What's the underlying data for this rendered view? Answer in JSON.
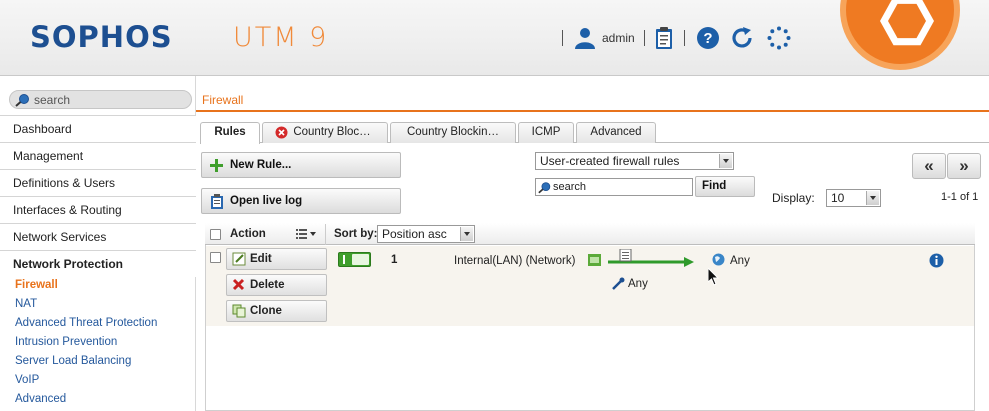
{
  "header": {
    "logo": "SOPHOS",
    "product": "UTM 9",
    "user": "admin"
  },
  "sidebar": {
    "search_placeholder": "search",
    "items": [
      "Dashboard",
      "Management",
      "Definitions & Users",
      "Interfaces & Routing",
      "Network Services",
      "Network Protection"
    ],
    "subitems": [
      "Firewall",
      "NAT",
      "Advanced Threat Protection",
      "Intrusion Prevention",
      "Server Load Balancing",
      "VoIP",
      "Advanced"
    ]
  },
  "breadcrumb": "Firewall",
  "tabs": [
    "Rules",
    "Country Bloc…",
    "Country Blockin…",
    "ICMP",
    "Advanced"
  ],
  "toolbar": {
    "new_rule": "New Rule...",
    "open_live_log": "Open live log",
    "filter_select": "User-created firewall rules",
    "search_value": "search",
    "find": "Find",
    "display_label": "Display:",
    "display_value": "10",
    "page_info": "1-1 of 1",
    "prev": "«",
    "next": "»"
  },
  "table": {
    "action_header": "Action",
    "sort_label": "Sort by:",
    "sort_value": "Position asc",
    "rows": [
      {
        "edit": "Edit",
        "delete": "Delete",
        "clone": "Clone",
        "position": "1",
        "source": "Internal(LAN) (Network)",
        "destination": "Any",
        "service": "Any"
      }
    ]
  },
  "colors": {
    "brand_blue": "#1d4f91",
    "accent_orange": "#e8731c",
    "toggle_green": "#3f9e2c"
  }
}
